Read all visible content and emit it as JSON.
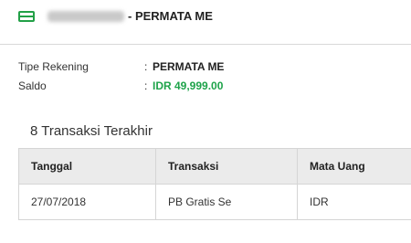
{
  "header": {
    "icon": "credit-card-icon",
    "account_suffix": "- PERMATA ME",
    "accent_color": "#22a047"
  },
  "info": {
    "type_label": "Tipe Rekening",
    "type_value": "PERMATA ME",
    "balance_label": "Saldo",
    "balance_value": "IDR 49,999.00",
    "separator": ":"
  },
  "transactions": {
    "title": "8 Transaksi Terakhir",
    "columns": [
      "Tanggal",
      "Transaksi",
      "Mata Uang"
    ],
    "rows": [
      [
        "27/07/2018",
        "PB Gratis Se",
        "IDR"
      ]
    ]
  }
}
